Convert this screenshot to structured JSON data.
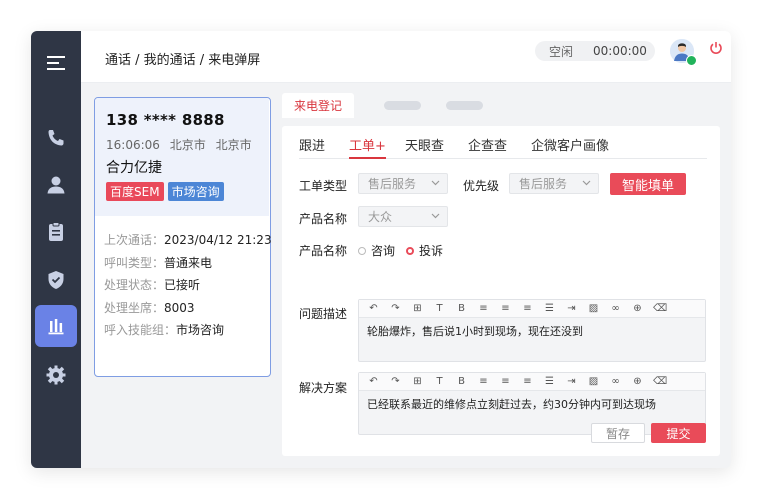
{
  "sidebar": {
    "items": [
      {
        "icon": "menu-icon"
      },
      {
        "icon": "phone-icon"
      },
      {
        "icon": "user-icon"
      },
      {
        "icon": "clipboard-icon"
      },
      {
        "icon": "shield-icon"
      },
      {
        "icon": "bar-chart-icon",
        "active": true
      },
      {
        "icon": "gear-icon"
      }
    ]
  },
  "header": {
    "breadcrumb": "通话 / 我的通话 / 来电弹屏",
    "status": "空闲",
    "timer": "00:00:00"
  },
  "call": {
    "phone": "138 **** 8888",
    "time": "16:06:06",
    "province": "北京市",
    "city": "北京市",
    "company": "合力亿捷",
    "tags": [
      "百度SEM",
      "市场咨询"
    ],
    "details": [
      {
        "label": "上次通话：",
        "value": "2023/04/12 21:23"
      },
      {
        "label": "呼叫类型：",
        "value": "普通来电"
      },
      {
        "label": "处理状态：",
        "value": "已接听"
      },
      {
        "label": "处理坐席：",
        "value": "8003"
      },
      {
        "label": "呼入技能组：",
        "value": "市场咨询"
      }
    ]
  },
  "main_tab": "来电登记",
  "subtabs": [
    "跟进",
    "工单+",
    "天眼查",
    "企查查",
    "企微客户画像"
  ],
  "form": {
    "ticket_type_label": "工单类型",
    "ticket_type_value": "售后服务",
    "priority_label": "优先级",
    "priority_value": "售后服务",
    "smart_fill": "智能填单",
    "product_label": "产品名称",
    "product_value": "大众",
    "product2_label": "产品名称",
    "radio_consult": "咨询",
    "radio_complaint": "投诉",
    "problem_label": "问题描述",
    "problem_text": "轮胎爆炸，售后说1小时到现场，现在还没到",
    "solution_label": "解决方案",
    "solution_text": "已经联系最近的维修点立刻赶过去，约30分钟内可到达现场",
    "save": "暂存",
    "submit": "提交"
  },
  "colors": {
    "sidebar": "#2f3645",
    "sidebar_active": "#6a82e6",
    "accent_red": "#e94b59",
    "tag_blue": "#4c86d6"
  }
}
